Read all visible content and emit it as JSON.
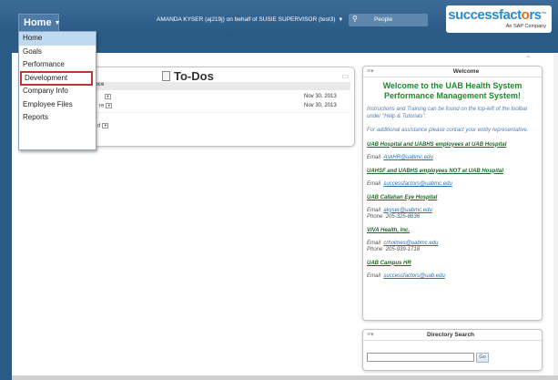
{
  "header": {
    "home_label": "Home",
    "user_line": "AMANDA KYSER (aj219j) on behalf of SUSIE SUPERVISOR (test3)",
    "search_label": "People"
  },
  "logo": {
    "main_a": "successfact",
    "main_o": "o",
    "main_b": "rs",
    "tm": "™",
    "sub": "An SAP Company"
  },
  "menu": {
    "items": [
      {
        "label": "Home"
      },
      {
        "label": "Goals"
      },
      {
        "label": "Performance"
      },
      {
        "label": "Development"
      },
      {
        "label": "Company Info"
      },
      {
        "label": "Employee Files"
      },
      {
        "label": "Reports"
      }
    ]
  },
  "todos": {
    "title": "To-Dos",
    "header": "nce",
    "rows": [
      {
        "label": "",
        "date": "Nov 30, 2013"
      },
      {
        "label": "re",
        "date": "Nov 30, 2013"
      },
      {
        "label": "d",
        "date": ""
      }
    ]
  },
  "welcome": {
    "header": "Welcome",
    "headline": "Welcome to the UAB Health System Performance Management System!",
    "instructions": "Instructions and Training can be found on the top-left of the toolbar under \"Help & Tutorials\".",
    "assistance": "For additional assistance please contact your entity representative.",
    "sections": [
      {
        "title": "UAB Hospital and UABHS employees at UAB Hospital",
        "email_label": "Email",
        "email": "AskHR@uabmc.edu",
        "phone_label": "",
        "phone": ""
      },
      {
        "title": "UAHSF and UABHS employees NOT at UAB Hospital",
        "email_label": "Email",
        "email": "successfactors@uabmc.edu",
        "phone_label": "",
        "phone": ""
      },
      {
        "title": "UAB Callahan Eye Hospital",
        "email_label": "Email",
        "email": "akyser@uabmc.edu",
        "phone_label": "Phone",
        "phone": "205-325-8636"
      },
      {
        "title": "VIVA Health, Inc.",
        "email_label": "Email",
        "email": "crholmes@uabmc.edu",
        "phone_label": "Phone",
        "phone": "205-939-1718"
      },
      {
        "title": "UAB Campus HR",
        "email_label": "Email",
        "email": "successfactors@uab.edu",
        "phone_label": "",
        "phone": ""
      }
    ]
  },
  "directory": {
    "header": "Directory Search",
    "go_label": "Go"
  }
}
